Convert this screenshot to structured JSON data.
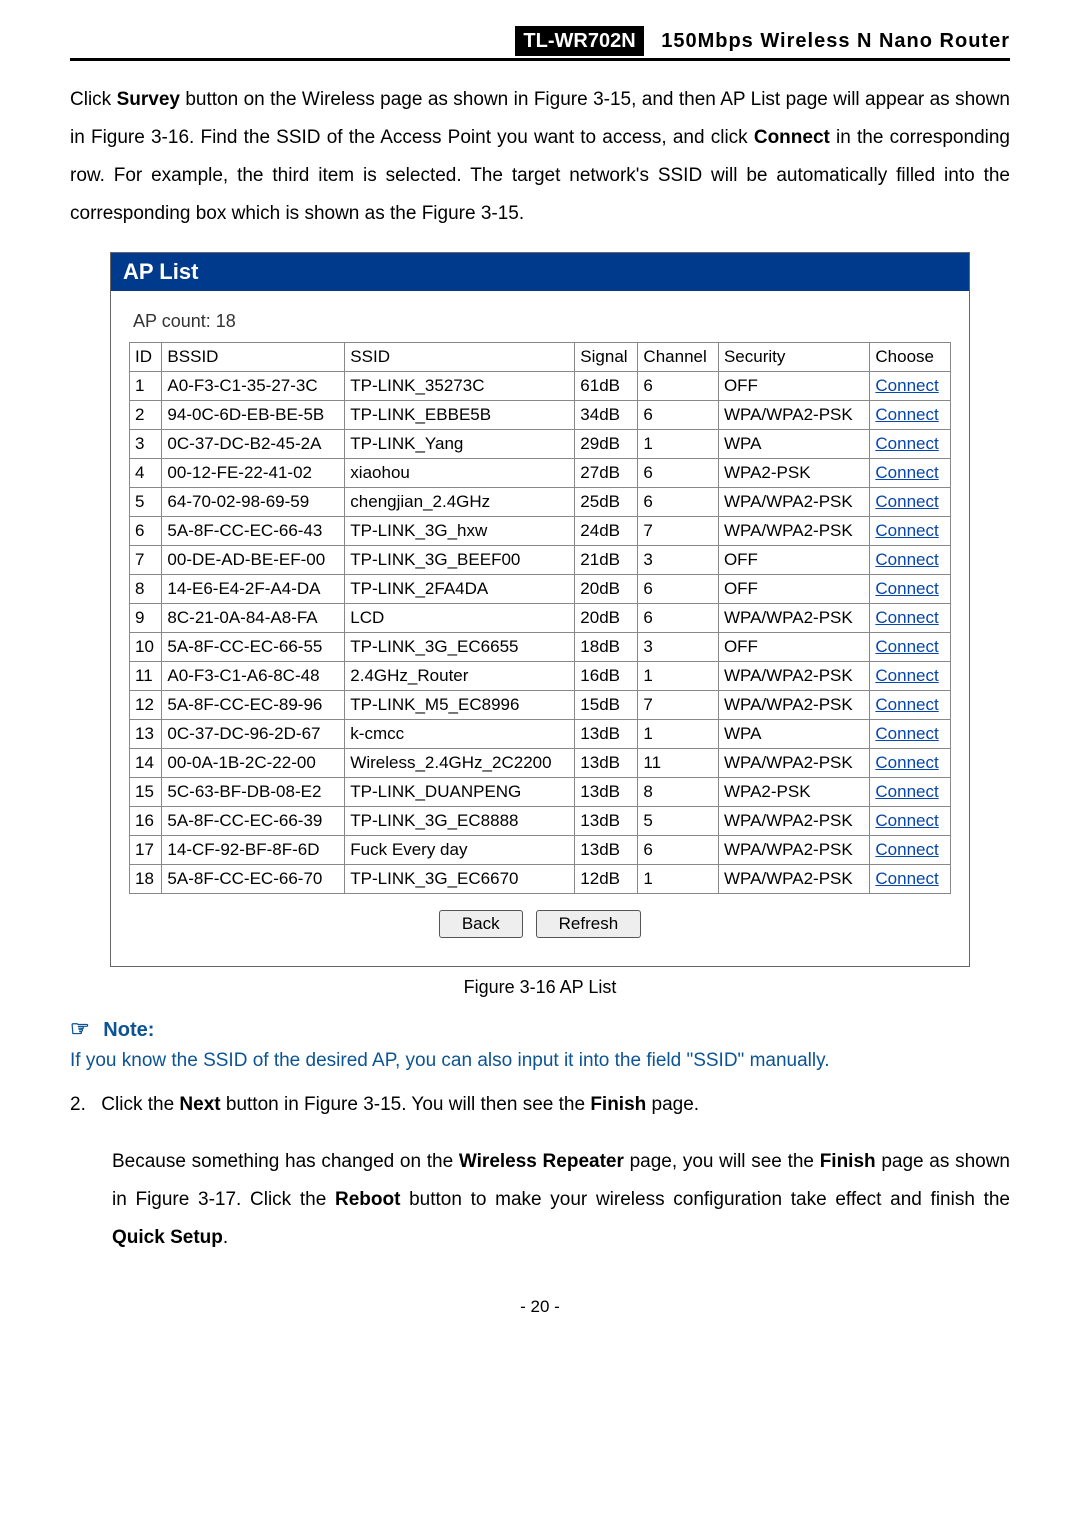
{
  "header": {
    "model": "TL-WR702N",
    "desc": "150Mbps  Wireless  N  Nano  Router"
  },
  "intro": "Click Survey button on the Wireless page as shown in Figure 3-15, and then AP List page will appear as shown in Figure 3-16. Find the SSID of the Access Point you want to access, and click Connect in the corresponding row. For example, the third item is selected. The target network's SSID will be automatically filled into the corresponding box which is shown as the Figure 3-15.",
  "apbox": {
    "title": "AP List",
    "count_label": "AP count:  18",
    "headers": {
      "id": "ID",
      "bssid": "BSSID",
      "ssid": "SSID",
      "signal": "Signal",
      "channel": "Channel",
      "security": "Security",
      "choose": "Choose"
    },
    "rows": [
      {
        "id": "1",
        "bssid": "A0-F3-C1-35-27-3C",
        "ssid": "TP-LINK_35273C",
        "signal": "61dB",
        "channel": "6",
        "security": "OFF",
        "choose": "Connect"
      },
      {
        "id": "2",
        "bssid": "94-0C-6D-EB-BE-5B",
        "ssid": "TP-LINK_EBBE5B",
        "signal": "34dB",
        "channel": "6",
        "security": "WPA/WPA2-PSK",
        "choose": "Connect"
      },
      {
        "id": "3",
        "bssid": "0C-37-DC-B2-45-2A",
        "ssid": "TP-LINK_Yang",
        "signal": "29dB",
        "channel": "1",
        "security": "WPA",
        "choose": "Connect"
      },
      {
        "id": "4",
        "bssid": "00-12-FE-22-41-02",
        "ssid": "xiaohou",
        "signal": "27dB",
        "channel": "6",
        "security": "WPA2-PSK",
        "choose": "Connect"
      },
      {
        "id": "5",
        "bssid": "64-70-02-98-69-59",
        "ssid": "chengjian_2.4GHz",
        "signal": "25dB",
        "channel": "6",
        "security": "WPA/WPA2-PSK",
        "choose": "Connect"
      },
      {
        "id": "6",
        "bssid": "5A-8F-CC-EC-66-43",
        "ssid": "TP-LINK_3G_hxw",
        "signal": "24dB",
        "channel": "7",
        "security": "WPA/WPA2-PSK",
        "choose": "Connect"
      },
      {
        "id": "7",
        "bssid": "00-DE-AD-BE-EF-00",
        "ssid": "TP-LINK_3G_BEEF00",
        "signal": "21dB",
        "channel": "3",
        "security": "OFF",
        "choose": "Connect"
      },
      {
        "id": "8",
        "bssid": "14-E6-E4-2F-A4-DA",
        "ssid": "TP-LINK_2FA4DA",
        "signal": "20dB",
        "channel": "6",
        "security": "OFF",
        "choose": "Connect"
      },
      {
        "id": "9",
        "bssid": "8C-21-0A-84-A8-FA",
        "ssid": "LCD",
        "signal": "20dB",
        "channel": "6",
        "security": "WPA/WPA2-PSK",
        "choose": "Connect"
      },
      {
        "id": "10",
        "bssid": "5A-8F-CC-EC-66-55",
        "ssid": "TP-LINK_3G_EC6655",
        "signal": "18dB",
        "channel": "3",
        "security": "OFF",
        "choose": "Connect"
      },
      {
        "id": "11",
        "bssid": "A0-F3-C1-A6-8C-48",
        "ssid": "2.4GHz_Router",
        "signal": "16dB",
        "channel": "1",
        "security": "WPA/WPA2-PSK",
        "choose": "Connect"
      },
      {
        "id": "12",
        "bssid": "5A-8F-CC-EC-89-96",
        "ssid": "TP-LINK_M5_EC8996",
        "signal": "15dB",
        "channel": "7",
        "security": "WPA/WPA2-PSK",
        "choose": "Connect"
      },
      {
        "id": "13",
        "bssid": "0C-37-DC-96-2D-67",
        "ssid": "k-cmcc",
        "signal": "13dB",
        "channel": "1",
        "security": "WPA",
        "choose": "Connect"
      },
      {
        "id": "14",
        "bssid": "00-0A-1B-2C-22-00",
        "ssid": "Wireless_2.4GHz_2C2200",
        "signal": "13dB",
        "channel": "11",
        "security": "WPA/WPA2-PSK",
        "choose": "Connect"
      },
      {
        "id": "15",
        "bssid": "5C-63-BF-DB-08-E2",
        "ssid": "TP-LINK_DUANPENG",
        "signal": "13dB",
        "channel": "8",
        "security": "WPA2-PSK",
        "choose": "Connect"
      },
      {
        "id": "16",
        "bssid": "5A-8F-CC-EC-66-39",
        "ssid": "TP-LINK_3G_EC8888",
        "signal": "13dB",
        "channel": "5",
        "security": "WPA/WPA2-PSK",
        "choose": "Connect"
      },
      {
        "id": "17",
        "bssid": "14-CF-92-BF-8F-6D",
        "ssid": "Fuck Every day",
        "signal": "13dB",
        "channel": "6",
        "security": "WPA/WPA2-PSK",
        "choose": "Connect"
      },
      {
        "id": "18",
        "bssid": "5A-8F-CC-EC-66-70",
        "ssid": "TP-LINK_3G_EC6670",
        "signal": "12dB",
        "channel": "1",
        "security": "WPA/WPA2-PSK",
        "choose": "Connect"
      }
    ],
    "buttons": {
      "back": "Back",
      "refresh": "Refresh"
    }
  },
  "caption": "Figure 3-16 AP List",
  "note": {
    "head": "Note:",
    "text": "If you know the SSID of the desired AP, you can also input it into the field \"SSID\" manually."
  },
  "step2": {
    "num": "2.",
    "line1": "Click the Next button in Figure 3-15. You will then see the Finish page.",
    "line2": "Because something has changed on the Wireless Repeater page, you will see the Finish page as shown in Figure 3-17. Click the Reboot button to make your wireless configuration take effect and finish the Quick Setup."
  },
  "pagenum": "- 20 -"
}
